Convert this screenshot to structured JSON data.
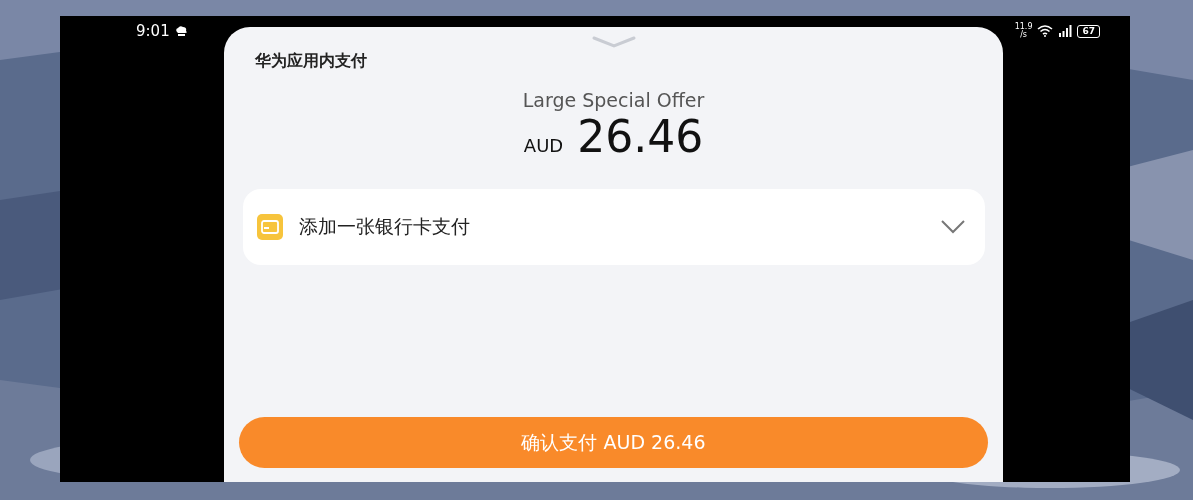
{
  "status_bar": {
    "time": "9:01",
    "speed": "11.9",
    "speed_unit": "/s",
    "battery": "67"
  },
  "sheet": {
    "title": "华为应用内支付",
    "product": "Large Special Offer",
    "currency": "AUD",
    "amount": "26.46",
    "payment_method": {
      "label": "添加一张银行卡支付",
      "expanded": false
    },
    "confirm_button": "确认支付 AUD 26.46"
  }
}
